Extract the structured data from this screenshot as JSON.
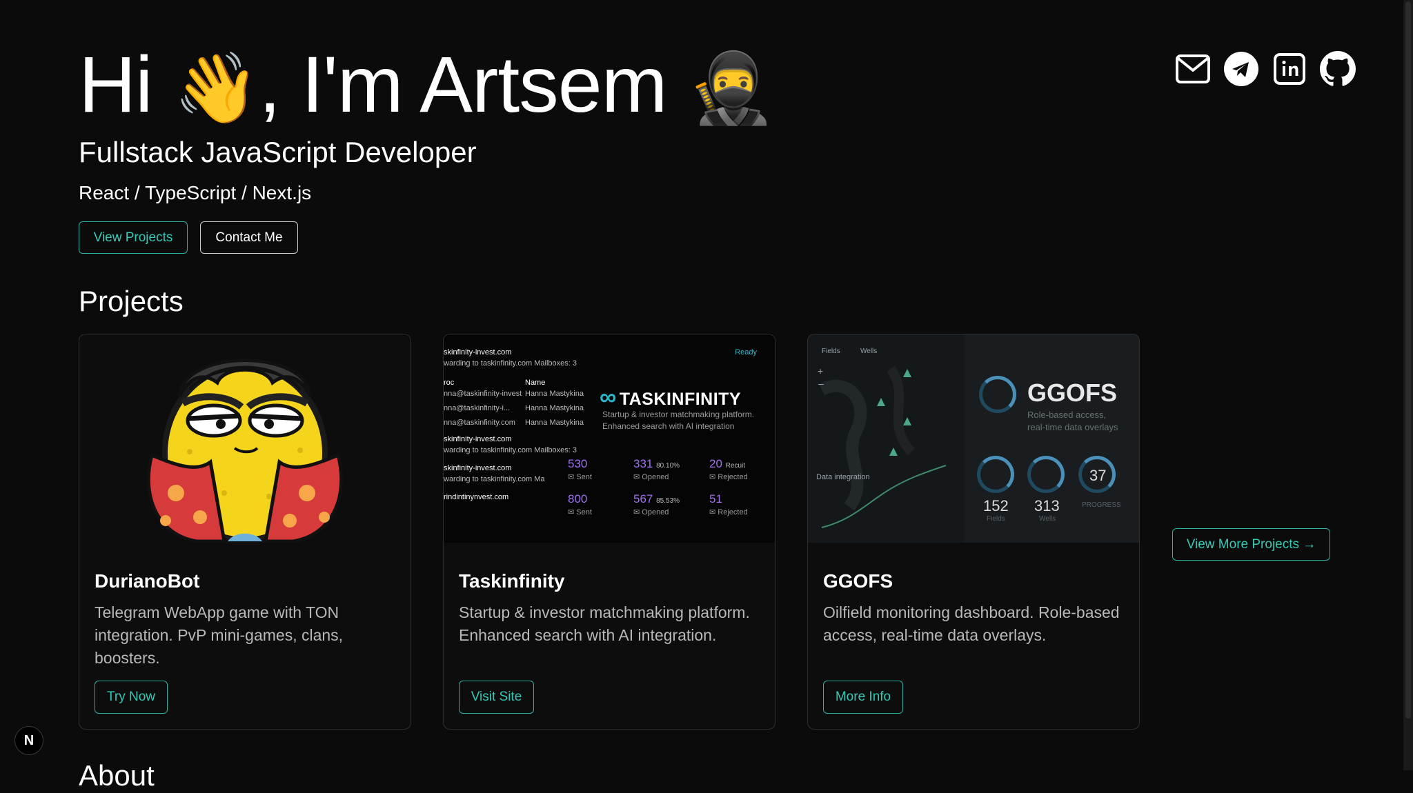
{
  "hero": {
    "greeting": "Hi ",
    "wave_emoji": "👋",
    "name_text": ", I'm Artsem ",
    "ninja_emoji": "🥷",
    "role": "Fullstack JavaScript Developer",
    "stack": "React / TypeScript / Next.js",
    "view_projects_label": "View Projects",
    "contact_label": "Contact Me"
  },
  "social": [
    "mail-icon",
    "telegram-icon",
    "linkedin-icon",
    "github-icon"
  ],
  "projects": {
    "title": "Projects",
    "view_more_label": "View More Projects →",
    "items": [
      {
        "name": "DurianoBot",
        "description": "Telegram WebApp game with TON integration. PvP mini-games, clans, boosters.",
        "button": "Try Now"
      },
      {
        "name": "Taskinfinity",
        "description": "Startup & investor matchmaking platform. Enhanced search with AI integration.",
        "button": "Visit Site"
      },
      {
        "name": "GGOFS",
        "description": "Oilfield monitoring dashboard. Role-based access, real-time data overlays.",
        "button": "More Info"
      }
    ]
  },
  "next_section_title": "About",
  "taskinfinity_thumb": {
    "ready": "Ready",
    "row1_domain": "skinfinity-invest.com",
    "row1_fwd": "warding to   taskinfinity.com    Mailboxes: 3",
    "col_roc": "roc",
    "col_name": "Name",
    "email1": "nna@taskinfinity-invest",
    "email2": "nna@taskinfinity-i...",
    "email3": "nna@taskinfinity.com",
    "person": "Hanna Mastykina",
    "row2_domain": "skinfinity-invest.com",
    "row2_fwd": "warding to   taskinfinity.com    Mailboxes: 3",
    "row3_domain": "skinfinity-invest.com",
    "row3_fwd": "warding to   taskinfinity.com   Ma",
    "row4_domain": "rindintinynvest.com",
    "logo": "TASKINFINITY",
    "tagline1": "Startup & investor matchmaking platform.",
    "tagline2": "Enhanced search with AI integration",
    "s1": "530",
    "s1l": "Sent",
    "s2": "331",
    "s2p": "80.10%",
    "s2l": "Opened",
    "s3": "20",
    "s3p": "Recuit",
    "s3l": "Rejected",
    "s4": "800",
    "s4l": "Sent",
    "s5": "567",
    "s5p": "85.53%",
    "s5l": "Opened",
    "s6": "51",
    "s6l": "Rejected"
  },
  "ggofs_thumb": {
    "tab1": "Fields",
    "tab2": "Wells",
    "title": "GGOFS",
    "sub1": "Role-based access,",
    "sub2": "real-time data overlays",
    "data_integration": "Data integration",
    "n1": "152",
    "n1l": "Fields",
    "n2": "313",
    "n2l": "Wells",
    "n3": "37",
    "n3l": "PROGRESS"
  },
  "colors": {
    "accent": "#36c9b6",
    "background": "#0b0b0b"
  }
}
